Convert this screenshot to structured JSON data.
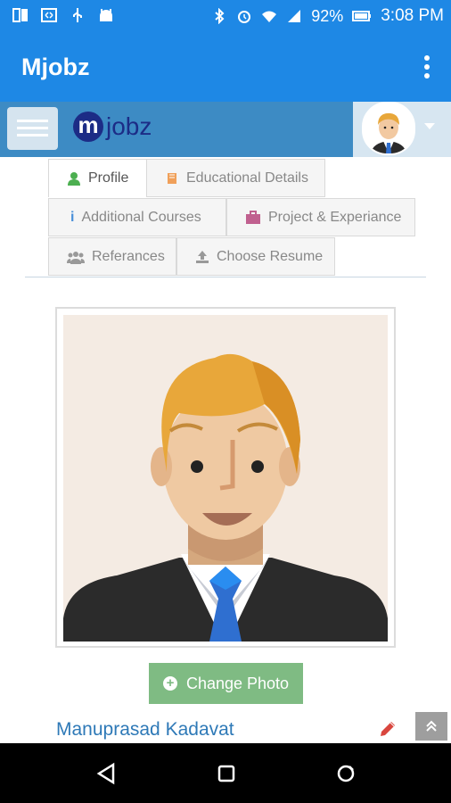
{
  "status_bar": {
    "battery": "92%",
    "time": "3:08 PM",
    "icons": [
      "screen-icon",
      "code-icon",
      "usb-icon",
      "android-icon",
      "bluetooth-icon",
      "alarm-icon",
      "wifi-icon",
      "signal-icon",
      "battery-icon"
    ]
  },
  "app": {
    "title": "Mjobz",
    "menu_icon": "more-vert-icon"
  },
  "site": {
    "logo_letter": "m",
    "logo_text": "jobz",
    "menu_icon": "hamburger-icon",
    "user_avatar": "avatar",
    "user_caret": "caret-down-icon"
  },
  "tabs": [
    {
      "label": "Profile",
      "icon": "user-icon",
      "icon_color": "#4caf50",
      "active": true
    },
    {
      "label": "Educational Details",
      "icon": "book-icon",
      "icon_color": "#f0a05a"
    },
    {
      "label": "Additional Courses",
      "icon": "info-icon",
      "icon_color": "#4a90d9"
    },
    {
      "label": "Project & Experiance",
      "icon": "briefcase-icon",
      "icon_color": "#c0608f"
    },
    {
      "label": "Referances",
      "icon": "users-icon",
      "icon_color": "#999999"
    },
    {
      "label": "Choose Resume",
      "icon": "upload-icon",
      "icon_color": "#999999"
    }
  ],
  "profile": {
    "change_photo_label": "Change Photo",
    "name": "Manuprasad Kadavat",
    "edit_icon": "pencil-icon"
  },
  "scroll_top_icon": "double-chevron-up-icon",
  "nav": [
    "back-icon",
    "home-icon",
    "recents-icon"
  ],
  "colors": {
    "primary": "#1e88e5",
    "web_bar": "#3d8bc4",
    "button_green": "#7fbb83",
    "name_link": "#2e79b7"
  }
}
